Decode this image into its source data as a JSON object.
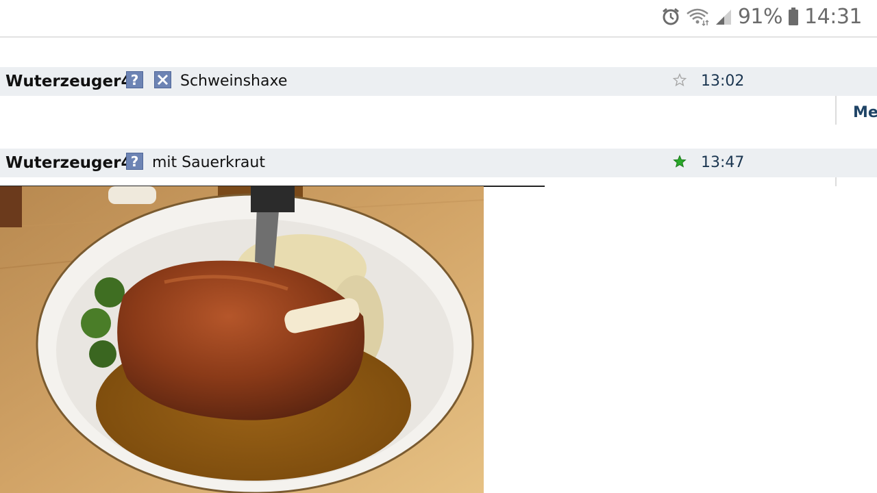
{
  "status_bar": {
    "icons": [
      "alarm-icon",
      "wifi-icon",
      "signal-icon",
      "battery-icon"
    ],
    "battery_percent": "91%",
    "time": "14:31"
  },
  "messages": [
    {
      "user": "Wuterzeuger4.:",
      "text": "Schweinshaxe",
      "time": "13:02",
      "starred": false,
      "icons": [
        "help-icon",
        "close-box-icon"
      ]
    },
    {
      "user": "Wuterzeuger4.:",
      "text": "mit Sauerkraut",
      "time": "13:47",
      "starred": true,
      "icons": [
        "help-icon"
      ]
    }
  ],
  "side": {
    "link_label": "Mel"
  },
  "colors": {
    "row_bg": "#eceff2",
    "time_text": "#1a3550",
    "icon_bg": "#6d84b4",
    "star_green": "#2aa82a"
  }
}
